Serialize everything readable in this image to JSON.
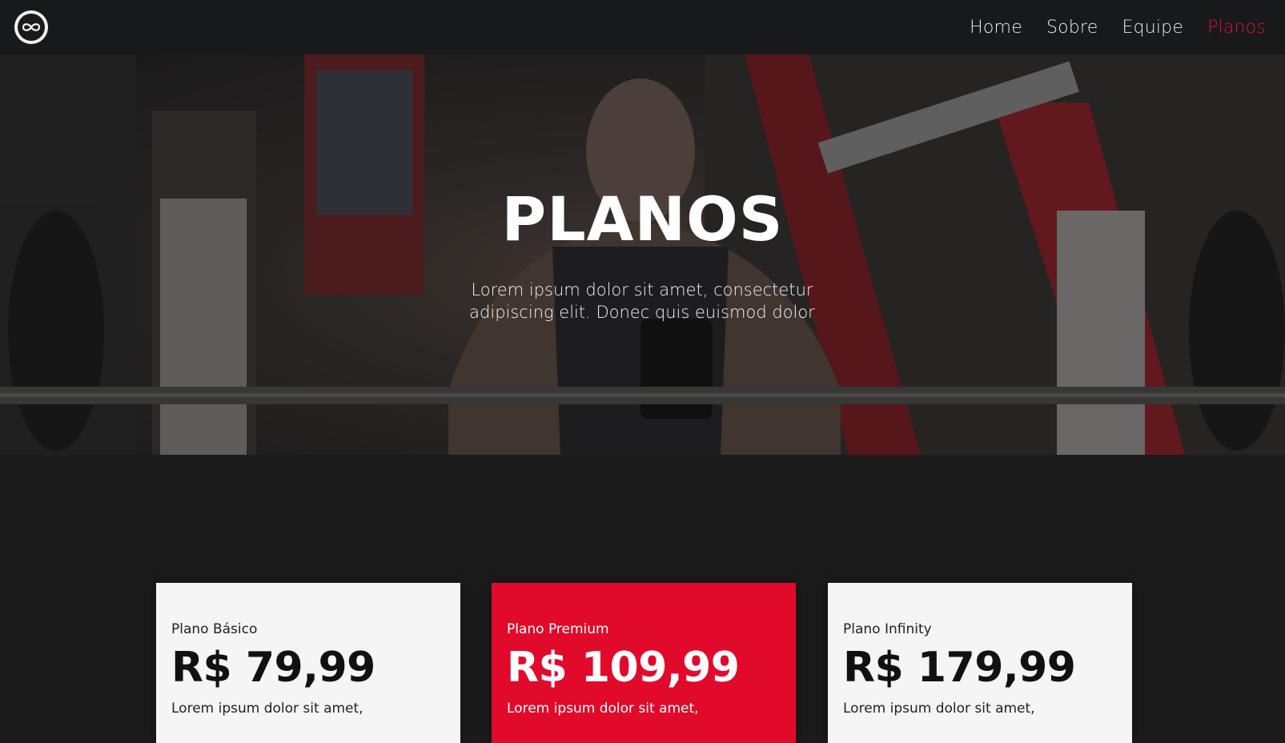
{
  "nav": {
    "logo_icon": "infinity-logo-icon",
    "links": [
      {
        "label": "Home",
        "active": false
      },
      {
        "label": "Sobre",
        "active": false
      },
      {
        "label": "Equipe",
        "active": false
      },
      {
        "label": "Planos",
        "active": true
      }
    ]
  },
  "hero": {
    "title": "PLANOS",
    "subtitle": "Lorem ipsum dolor sit amet, consectetur adipiscing elit. Donec quis euismod dolor"
  },
  "plans": [
    {
      "name": "Plano Básico",
      "price": "R$ 79,99",
      "description": "Lorem ipsum dolor sit amet,"
    },
    {
      "name": "Plano Premium",
      "price": "R$ 109,99",
      "description": "Lorem ipsum dolor sit amet,"
    },
    {
      "name": "Plano Infinity",
      "price": "R$ 179,99",
      "description": "Lorem ipsum dolor sit amet,"
    }
  ],
  "colors": {
    "accent": "#e10a2b",
    "navbar": "#18191b",
    "background": "#1b1b1c",
    "card": "#f5f5f5"
  }
}
